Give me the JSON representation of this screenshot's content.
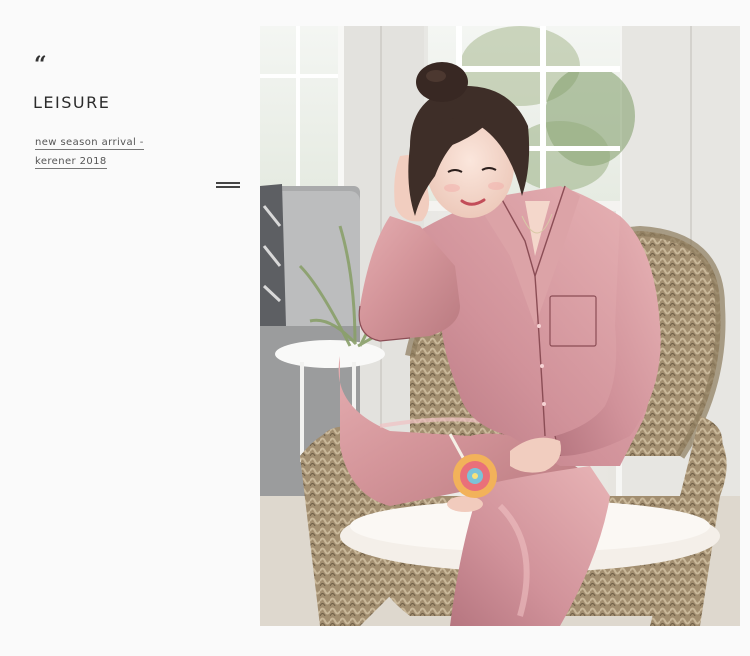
{
  "quote_mark": "“",
  "headline": "LEISURE",
  "tagline_line1": "new season arrival -",
  "tagline_line2": "kerener 2018",
  "menu_icon": "hamburger-lines-icon",
  "photo_subject": "",
  "colors": {
    "pajama": "#d6979b",
    "wall": "#eceae6",
    "wicker": "#a89576",
    "text": "#2b2b2b"
  }
}
